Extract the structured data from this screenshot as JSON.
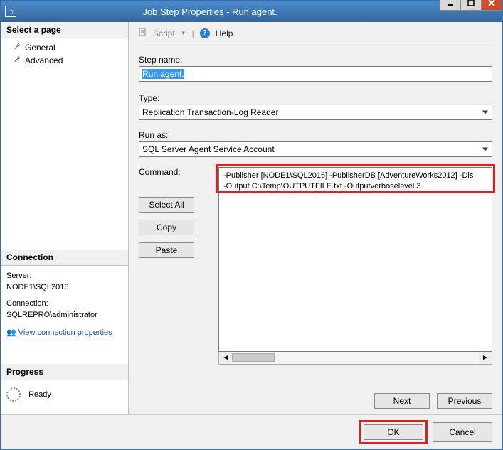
{
  "window": {
    "title": "Job Step Properties - Run agent."
  },
  "sidebar": {
    "select_page": "Select a page",
    "items": [
      "General",
      "Advanced"
    ],
    "connection_header": "Connection",
    "server_label": "Server:",
    "server_value": "NODE1\\SQL2016",
    "connection_label": "Connection:",
    "connection_value": "SQLREPRO\\administrator",
    "view_props": "View connection properties",
    "progress_header": "Progress",
    "progress_status": "Ready"
  },
  "toolbar": {
    "script": "Script",
    "help": "Help"
  },
  "form": {
    "step_name_label": "Step name:",
    "step_name_value": "Run agent.",
    "type_label": "Type:",
    "type_value": "Replication Transaction-Log Reader",
    "run_as_label": "Run as:",
    "run_as_value": "SQL Server Agent Service Account",
    "command_label": "Command:",
    "command_text": "-Publisher [NODE1\\SQL2016] -PublisherDB [AdventureWorks2012] -Dis\n-Output C:\\Temp\\OUTPUTFILE.txt -Outputverboselevel 3",
    "select_all": "Select All",
    "copy": "Copy",
    "paste": "Paste",
    "next": "Next",
    "previous": "Previous"
  },
  "footer": {
    "ok": "OK",
    "cancel": "Cancel"
  }
}
